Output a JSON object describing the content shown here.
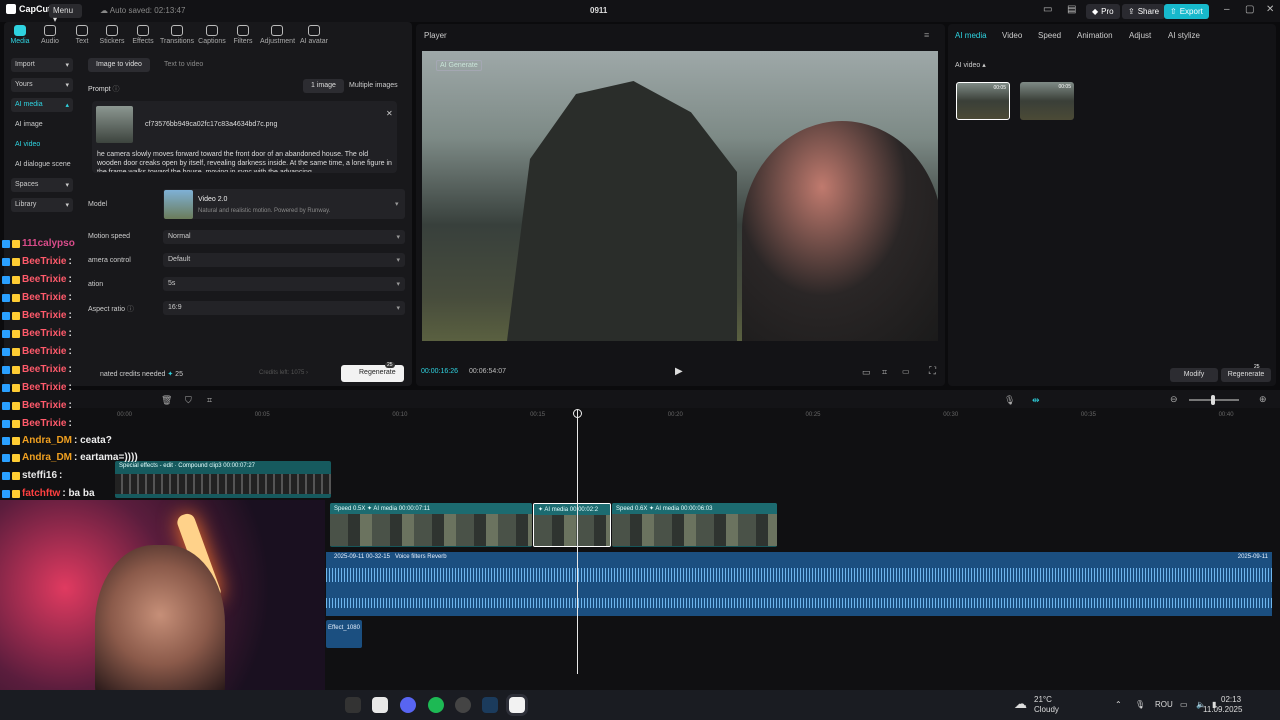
{
  "titlebar": {
    "app": "CapCut",
    "menu": "Menu",
    "autosave": "Auto saved: 02:13:47",
    "project": "0911",
    "pro": "Pro",
    "share": "Share",
    "export": "Export"
  },
  "tools": [
    {
      "label": "Media",
      "icon": "media-icon"
    },
    {
      "label": "Audio",
      "icon": "audio-icon"
    },
    {
      "label": "Text",
      "icon": "text-icon"
    },
    {
      "label": "Stickers",
      "icon": "stickers-icon"
    },
    {
      "label": "Effects",
      "icon": "effects-icon"
    },
    {
      "label": "Transitions",
      "icon": "transitions-icon"
    },
    {
      "label": "Captions",
      "icon": "captions-icon"
    },
    {
      "label": "Filters",
      "icon": "filters-icon"
    },
    {
      "label": "Adjustment",
      "icon": "adjustment-icon"
    },
    {
      "label": "AI avatar",
      "icon": "ai-avatar-icon"
    }
  ],
  "leftnav": {
    "import": "Import",
    "yours": "Yours",
    "ai_media": "AI media",
    "ai_image": "AI image",
    "ai_video": "AI video",
    "ai_dialogue": "AI dialogue scene",
    "spaces": "Spaces",
    "library": "Library"
  },
  "aigen": {
    "tab_image": "Image to video",
    "tab_text": "Text to video",
    "prompt_label": "Prompt",
    "one_image": "1 image",
    "multi_images": "Multiple images",
    "filename": "cf73576bb949ca02fc17c83a4634bd7c.png",
    "prompt_text": "he camera slowly moves forward toward the front door of an abandoned house. The old wooden door creaks open by itself, revealing darkness inside. At the same time, a lone figure in the frame walks toward the house, moving in sync with the advancing",
    "model_label": "Model",
    "model_name": "Video 2.0",
    "model_desc": "Natural and realistic motion. Powered by Runway.",
    "motion_label": "Motion speed",
    "motion_value": "Normal",
    "camera_label": "amera control",
    "camera_value": "Default",
    "duration_label": "ation",
    "duration_value": "5s",
    "aspect_label": "Aspect ratio",
    "aspect_value": "16:9",
    "credits_needed": "nated credits needed",
    "credits_num": "25",
    "credits_left": "Credits left: 1075",
    "regenerate": "Regenerate",
    "regen_badge": "25"
  },
  "player": {
    "title": "Player",
    "ai_badge": "AI Generate",
    "time_current": "00:00:16:26",
    "time_total": "00:06:54:07"
  },
  "right": {
    "tabs": [
      "AI media",
      "Video",
      "Speed",
      "Animation",
      "Adjust",
      "AI stylize"
    ],
    "section": "AI video",
    "thumb1": "00:05",
    "thumb2": "00:05",
    "modify": "Modify",
    "regenerate": "Regenerate",
    "regen_badge": "25"
  },
  "timeline": {
    "ruler": [
      "00:00",
      "00:05",
      "00:10",
      "00:15",
      "00:20",
      "00:25",
      "00:30",
      "00:35",
      "00:40"
    ],
    "compound": [
      "Special effects - edit",
      "Compound clip3",
      "00:00:07:27"
    ],
    "clips": [
      {
        "speed": "Speed 0.5X",
        "name": "AI media",
        "dur": "00:00:07:11"
      },
      {
        "speed": "",
        "name": "AI media",
        "dur": "00:00:02:2"
      },
      {
        "speed": "Speed 0.6X",
        "name": "AI media",
        "dur": "00:00:06:03"
      }
    ],
    "audio_left": "2025-09-11 00-32-15",
    "audio_fx": "Voice filters Reverb",
    "audio_right": "2025-09-11",
    "effect_clip": "Effect_1080"
  },
  "chat": [
    {
      "user": "111calypso",
      "msg": "",
      "color": "#d94c8a"
    },
    {
      "user": "BeeTrixie",
      "msg": ":",
      "color": "#ff5a6b"
    },
    {
      "user": "BeeTrixie",
      "msg": ":",
      "color": "#ff5a6b"
    },
    {
      "user": "BeeTrixie",
      "msg": ":",
      "color": "#ff5a6b"
    },
    {
      "user": "BeeTrixie",
      "msg": ":",
      "color": "#ff5a6b"
    },
    {
      "user": "BeeTrixie",
      "msg": ":",
      "color": "#ff5a6b"
    },
    {
      "user": "BeeTrixie",
      "msg": ":",
      "color": "#ff5a6b"
    },
    {
      "user": "BeeTrixie",
      "msg": ":",
      "color": "#ff5a6b"
    },
    {
      "user": "BeeTrixie",
      "msg": ":",
      "color": "#ff5a6b"
    },
    {
      "user": "BeeTrixie",
      "msg": ":",
      "color": "#ff5a6b"
    },
    {
      "user": "BeeTrixie",
      "msg": ":",
      "color": "#ff5a6b"
    },
    {
      "user": "Andra_DM",
      "msg": ": ceata?",
      "color": "#f0a020"
    },
    {
      "user": "Andra_DM",
      "msg": ": eartama=))))",
      "color": "#f0a020"
    },
    {
      "user": "steffi16",
      "msg": ":",
      "color": "#e8e8e8"
    },
    {
      "user": "fatchftw",
      "msg": ": ba ba",
      "color": "#ff4040"
    }
  ],
  "taskbar": {
    "temp": "21°C",
    "weather": "Cloudy",
    "lang": "ROU",
    "time": "02:13",
    "date": "11.09.2025"
  }
}
